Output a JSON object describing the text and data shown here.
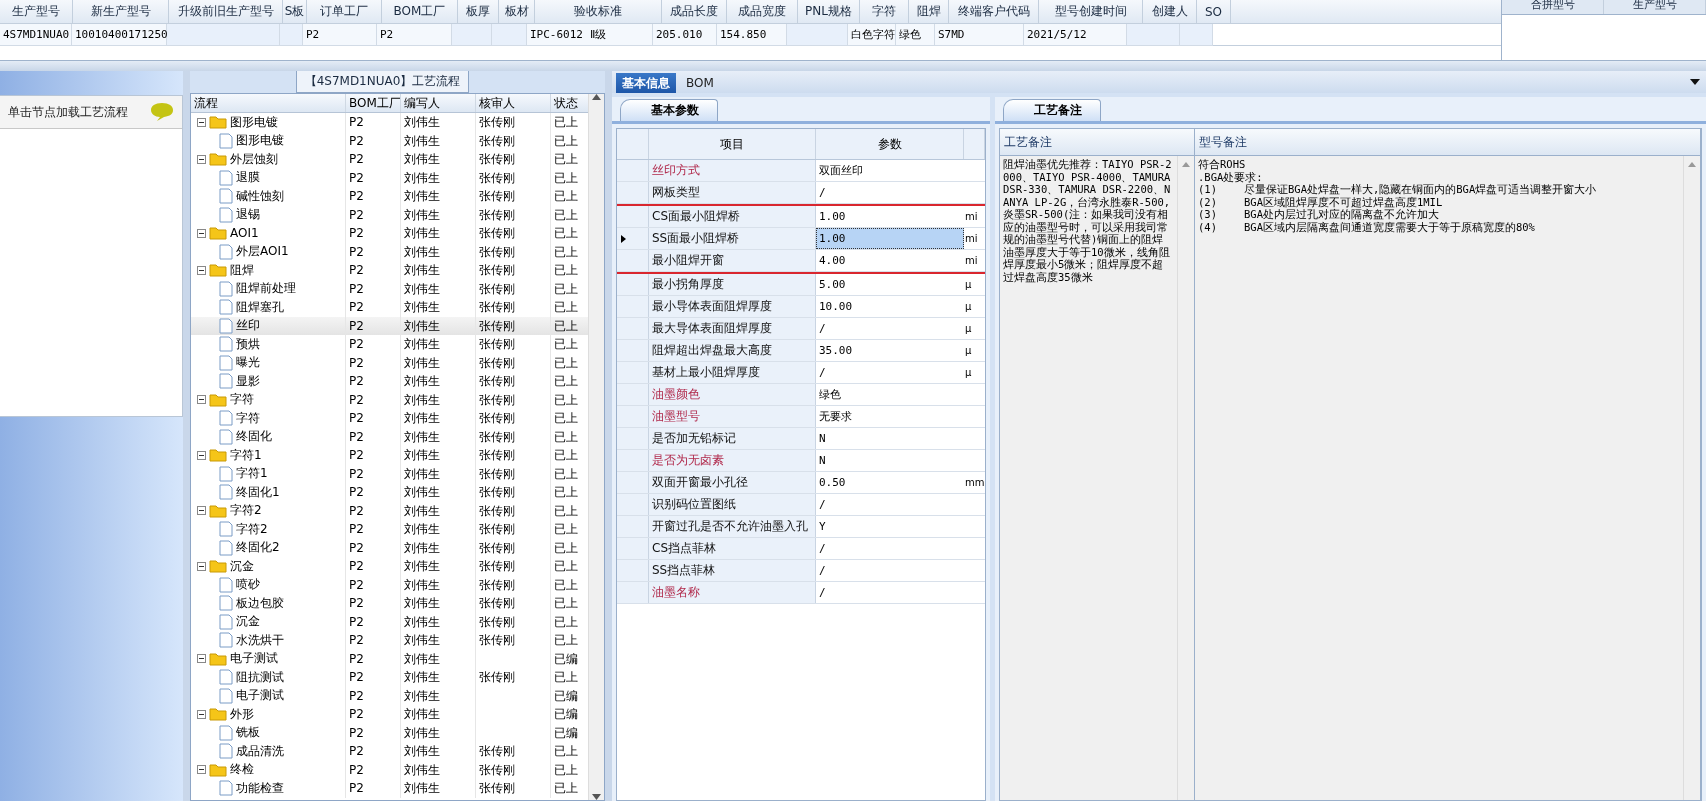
{
  "top_grid": {
    "columns": [
      {
        "label": "生产型号",
        "value": "4S7MD1NUA0"
      },
      {
        "label": "新生产型号",
        "value": "10010400171250"
      },
      {
        "label": "升级前旧生产型号"
      },
      {
        "label": "S板"
      },
      {
        "label": "订单工厂",
        "value": "P2"
      },
      {
        "label": "BOM工厂",
        "value": "P2"
      },
      {
        "label": "板厚"
      },
      {
        "label": "板材"
      },
      {
        "label": "验收标准",
        "value": "IPC-6012 Ⅱ级"
      },
      {
        "label": "成品长度",
        "value": "205.010"
      },
      {
        "label": "成品宽度",
        "value": "154.850"
      },
      {
        "label": "PNL规格"
      },
      {
        "label": "字符",
        "value": "白色字符"
      },
      {
        "label": "阻焊",
        "value": "绿色"
      },
      {
        "label": "终端客户代码",
        "value": "S7MD"
      },
      {
        "label": "型号创建时间",
        "value": "2021/5/12"
      },
      {
        "label": "创建人"
      },
      {
        "label": "SO"
      }
    ]
  },
  "merge_grid": {
    "columns": [
      "合拼型号",
      "生产型号"
    ]
  },
  "left_panel": {
    "hint": "单击节点加载工艺流程"
  },
  "flow_panel": {
    "title": "【4S7MD1NUA0】工艺流程",
    "columns": [
      "流程",
      "BOM工厂",
      "编写人",
      "核审人",
      "状态"
    ],
    "tree": [
      {
        "label": "图形电镀",
        "bom_factory": "P2",
        "author": "刘伟生",
        "reviewer": "张传刚",
        "status": "已上",
        "selected": false,
        "children": [
          {
            "label": "图形电镀",
            "bom_factory": "P2",
            "author": "刘伟生",
            "reviewer": "张传刚",
            "status": "已上",
            "selected": false
          }
        ]
      },
      {
        "label": "外层蚀刻",
        "bom_factory": "P2",
        "author": "刘伟生",
        "reviewer": "张传刚",
        "status": "已上",
        "selected": false,
        "children": [
          {
            "label": "退膜",
            "bom_factory": "P2",
            "author": "刘伟生",
            "reviewer": "张传刚",
            "status": "已上",
            "selected": false
          },
          {
            "label": "碱性蚀刻",
            "bom_factory": "P2",
            "author": "刘伟生",
            "reviewer": "张传刚",
            "status": "已上",
            "selected": false
          },
          {
            "label": "退锡",
            "bom_factory": "P2",
            "author": "刘伟生",
            "reviewer": "张传刚",
            "status": "已上",
            "selected": false
          }
        ]
      },
      {
        "label": "AOI1",
        "bom_factory": "P2",
        "author": "刘伟生",
        "reviewer": "张传刚",
        "status": "已上",
        "selected": false,
        "children": [
          {
            "label": "外层AOI1",
            "bom_factory": "P2",
            "author": "刘伟生",
            "reviewer": "张传刚",
            "status": "已上",
            "selected": false
          }
        ]
      },
      {
        "label": "阻焊",
        "bom_factory": "P2",
        "author": "刘伟生",
        "reviewer": "张传刚",
        "status": "已上",
        "selected": false,
        "children": [
          {
            "label": "阻焊前处理",
            "bom_factory": "P2",
            "author": "刘伟生",
            "reviewer": "张传刚",
            "status": "已上",
            "selected": false
          },
          {
            "label": "阻焊塞孔",
            "bom_factory": "P2",
            "author": "刘伟生",
            "reviewer": "张传刚",
            "status": "已上",
            "selected": false
          },
          {
            "label": "丝印",
            "bom_factory": "P2",
            "author": "刘伟生",
            "reviewer": "张传刚",
            "status": "已上",
            "selected": true
          },
          {
            "label": "预烘",
            "bom_factory": "P2",
            "author": "刘伟生",
            "reviewer": "张传刚",
            "status": "已上",
            "selected": false
          },
          {
            "label": "曝光",
            "bom_factory": "P2",
            "author": "刘伟生",
            "reviewer": "张传刚",
            "status": "已上",
            "selected": false
          },
          {
            "label": "显影",
            "bom_factory": "P2",
            "author": "刘伟生",
            "reviewer": "张传刚",
            "status": "已上",
            "selected": false
          }
        ]
      },
      {
        "label": "字符",
        "bom_factory": "P2",
        "author": "刘伟生",
        "reviewer": "张传刚",
        "status": "已上",
        "selected": false,
        "children": [
          {
            "label": "字符",
            "bom_factory": "P2",
            "author": "刘伟生",
            "reviewer": "张传刚",
            "status": "已上",
            "selected": false
          },
          {
            "label": "终固化",
            "bom_factory": "P2",
            "author": "刘伟生",
            "reviewer": "张传刚",
            "status": "已上",
            "selected": false
          }
        ]
      },
      {
        "label": "字符1",
        "bom_factory": "P2",
        "author": "刘伟生",
        "reviewer": "张传刚",
        "status": "已上",
        "selected": false,
        "children": [
          {
            "label": "字符1",
            "bom_factory": "P2",
            "author": "刘伟生",
            "reviewer": "张传刚",
            "status": "已上",
            "selected": false
          },
          {
            "label": "终固化1",
            "bom_factory": "P2",
            "author": "刘伟生",
            "reviewer": "张传刚",
            "status": "已上",
            "selected": false
          }
        ]
      },
      {
        "label": "字符2",
        "bom_factory": "P2",
        "author": "刘伟生",
        "reviewer": "张传刚",
        "status": "已上",
        "selected": false,
        "children": [
          {
            "label": "字符2",
            "bom_factory": "P2",
            "author": "刘伟生",
            "reviewer": "张传刚",
            "status": "已上",
            "selected": false
          },
          {
            "label": "终固化2",
            "bom_factory": "P2",
            "author": "刘伟生",
            "reviewer": "张传刚",
            "status": "已上",
            "selected": false
          }
        ]
      },
      {
        "label": "沉金",
        "bom_factory": "P2",
        "author": "刘伟生",
        "reviewer": "张传刚",
        "status": "已上",
        "selected": false,
        "children": [
          {
            "label": "喷砂",
            "bom_factory": "P2",
            "author": "刘伟生",
            "reviewer": "张传刚",
            "status": "已上",
            "selected": false
          },
          {
            "label": "板边包胶",
            "bom_factory": "P2",
            "author": "刘伟生",
            "reviewer": "张传刚",
            "status": "已上",
            "selected": false
          },
          {
            "label": "沉金",
            "bom_factory": "P2",
            "author": "刘伟生",
            "reviewer": "张传刚",
            "status": "已上",
            "selected": false
          },
          {
            "label": "水洗烘干",
            "bom_factory": "P2",
            "author": "刘伟生",
            "reviewer": "张传刚",
            "status": "已上",
            "selected": false
          }
        ]
      },
      {
        "label": "电子测试",
        "bom_factory": "P2",
        "author": "刘伟生",
        "status": "已编",
        "selected": false,
        "children": [
          {
            "label": "阻抗测试",
            "bom_factory": "P2",
            "author": "刘伟生",
            "reviewer": "张传刚",
            "status": "已上",
            "selected": false
          },
          {
            "label": "电子测试",
            "bom_factory": "P2",
            "author": "刘伟生",
            "status": "已编",
            "selected": false
          }
        ]
      },
      {
        "label": "外形",
        "bom_factory": "P2",
        "author": "刘伟生",
        "status": "已编",
        "selected": false,
        "children": [
          {
            "label": "铣板",
            "bom_factory": "P2",
            "author": "刘伟生",
            "status": "已编",
            "selected": false
          },
          {
            "label": "成品清洗",
            "bom_factory": "P2",
            "author": "刘伟生",
            "reviewer": "张传刚",
            "status": "已上",
            "selected": false
          }
        ]
      },
      {
        "label": "终检",
        "bom_factory": "P2",
        "author": "刘伟生",
        "reviewer": "张传刚",
        "status": "已上",
        "selected": false,
        "children": [
          {
            "label": "功能检查",
            "bom_factory": "P2",
            "author": "刘伟生",
            "reviewer": "张传刚",
            "status": "已上",
            "selected": false
          }
        ]
      }
    ]
  },
  "tabs": [
    {
      "label": "基本信息",
      "selected": true
    },
    {
      "label": "BOM",
      "selected": false
    }
  ],
  "params_panel": {
    "tab": "基本参数",
    "columns": [
      "项目",
      "参数"
    ],
    "rows": [
      {
        "item": "丝印方式",
        "value": "双面丝印",
        "unit": null,
        "required": true,
        "boxed": false,
        "selected": false
      },
      {
        "item": "网板类型",
        "value": "/",
        "unit": null,
        "required": false,
        "boxed": false,
        "selected": false
      },
      {
        "item": "CS面最小阻焊桥",
        "value": "1.00",
        "unit": "mi",
        "required": false,
        "boxed": true,
        "selected": false
      },
      {
        "item": "SS面最小阻焊桥",
        "value": "1.00",
        "unit": "mi",
        "required": false,
        "boxed": true,
        "selected": true
      },
      {
        "item": "最小阻焊开窗",
        "value": "4.00",
        "unit": "mi",
        "required": false,
        "boxed": true,
        "selected": false
      },
      {
        "item": "最小拐角厚度",
        "value": "5.00",
        "unit": "μ",
        "required": false,
        "boxed": false,
        "selected": false
      },
      {
        "item": "最小导体表面阻焊厚度",
        "value": "10.00",
        "unit": "μ",
        "required": false,
        "boxed": false,
        "selected": false
      },
      {
        "item": "最大导体表面阻焊厚度",
        "value": "/",
        "unit": "μ",
        "required": false,
        "boxed": false,
        "selected": false
      },
      {
        "item": "阻焊超出焊盘最大高度",
        "value": "35.00",
        "unit": "μ",
        "required": false,
        "boxed": false,
        "selected": false
      },
      {
        "item": "基材上最小阻焊厚度",
        "value": "/",
        "unit": "μ",
        "required": false,
        "boxed": false,
        "selected": false
      },
      {
        "item": "油墨颜色",
        "value": "绿色",
        "unit": null,
        "required": true,
        "boxed": false,
        "selected": false
      },
      {
        "item": "油墨型号",
        "value": "无要求",
        "unit": null,
        "required": true,
        "boxed": false,
        "selected": false
      },
      {
        "item": "是否加无铅标记",
        "value": "N",
        "unit": null,
        "required": false,
        "boxed": false,
        "selected": false
      },
      {
        "item": "是否为无卤素",
        "value": "N",
        "unit": null,
        "required": true,
        "boxed": false,
        "selected": false
      },
      {
        "item": "双面开窗最小孔径",
        "value": "0.50",
        "unit": "mm",
        "required": false,
        "boxed": false,
        "selected": false
      },
      {
        "item": "识别码位置图纸",
        "value": "/",
        "unit": null,
        "required": false,
        "boxed": false,
        "selected": false
      },
      {
        "item": "开窗过孔是否不允许油墨入孔",
        "value": "Y",
        "unit": null,
        "required": false,
        "boxed": false,
        "selected": false
      },
      {
        "item": "CS挡点菲林",
        "value": "/",
        "unit": null,
        "required": false,
        "boxed": false,
        "selected": false
      },
      {
        "item": "SS挡点菲林",
        "value": "/",
        "unit": null,
        "required": false,
        "boxed": false,
        "selected": false
      },
      {
        "item": "油墨名称",
        "value": "/",
        "unit": null,
        "required": true,
        "boxed": false,
        "selected": false
      }
    ]
  },
  "notes_panel": {
    "tab": "工艺备注",
    "columns": [
      "工艺备注",
      "型号备注"
    ],
    "process_note": "阻焊油墨优先推荐：TAIYO PSR-2000、TAIYO PSR-4000、TAMURA DSR-330、TAMURA DSR-2200、NANYA LP-2G，台湾永胜泰R-500,炎墨SR-500(注：如果我司没有相应的油墨型号时，可以采用我司常规的油墨型号代替)铜面上的阻焊油墨厚度大于等于10微米，线角阻焊厚度最小5微米；阻焊厚度不超过焊盘高度35微米",
    "model_note": {
      "lines": [
        "符合ROHS",
        ".BGA处要求:"
      ],
      "items": [
        {
          "index": "(1)",
          "text": "尽量保证BGA处焊盘一样大,隐藏在铜面内的BGA焊盘可适当调整开窗大小"
        },
        {
          "index": "(2)",
          "text": "BGA区域阻焊厚度不可超过焊盘高度1MIL"
        },
        {
          "index": "(3)",
          "text": "BGA处内层过孔对应的隔离盘不允许加大"
        },
        {
          "index": "(4)",
          "text": "BGA区域内层隔离盘间通道宽度需要大于等于原稿宽度的80%"
        }
      ]
    }
  }
}
